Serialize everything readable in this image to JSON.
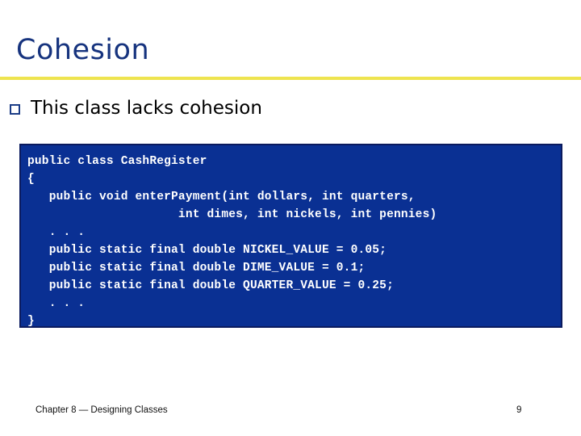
{
  "slide": {
    "title": "Cohesion",
    "title_color": "#16337E",
    "rule_color": "#EEE44F",
    "background_color": "#FFFFFF"
  },
  "bullet": {
    "marker": "hollow-square-bullet",
    "text": "This class lacks cohesion",
    "text_color": "#000000",
    "marker_color": "#1B3C86"
  },
  "code": {
    "background_color": "#0A3093",
    "border_color": "#0A1A5E",
    "text_color": "#FFFFFF",
    "language": "java",
    "lines": [
      "public class CashRegister",
      "{",
      "   public void enterPayment(int dollars, int quarters,",
      "                     int dimes, int nickels, int pennies)",
      "   . . .",
      "   public static final double NICKEL_VALUE = 0.05;",
      "   public static final double DIME_VALUE = 0.1;",
      "   public static final double QUARTER_VALUE = 0.25;",
      "   . . .",
      "}"
    ]
  },
  "footer": {
    "text": "Chapter 8 — Designing Classes",
    "page_number": "9"
  }
}
